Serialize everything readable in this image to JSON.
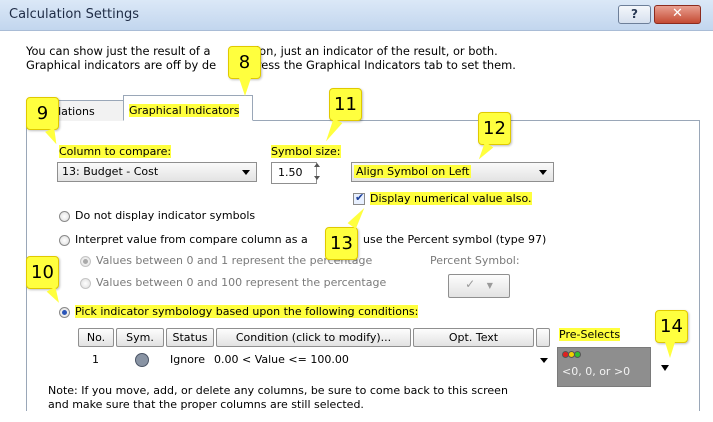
{
  "window": {
    "title": "Calculation Settings",
    "help_glyph": "?",
    "close_glyph": "✕"
  },
  "intro": {
    "line1_a": "You can show just the result of a",
    "line1_b": "ation, just an indicator of the result, or both.",
    "line2_a": "Graphical indicators are off by de",
    "line2_b": "Press the Graphical Indicators tab to set them."
  },
  "tabs": {
    "calculations": "lculations",
    "graphical": "Graphical Indicators"
  },
  "compare": {
    "label": "Column to compare:",
    "value": "13: Budget - Cost"
  },
  "symbol_size": {
    "label": "Symbol size:",
    "value": "1.50"
  },
  "align": {
    "value": "Align Symbol on Left"
  },
  "display_numeric": {
    "label": "Display numerical value also.",
    "checked": true
  },
  "options": {
    "none": "Do not display indicator symbols",
    "interpret_a": "Interpret value from compare column as a",
    "interpret_b": "use the Percent symbol (type 97)",
    "range01": "Values between 0 and 1 represent the percentage",
    "range0100": "Values between 0 and 100 represent the percentage",
    "percent_symbol_label": "Percent Symbol:",
    "pick": "Pick indicator symbology based upon the following conditions:"
  },
  "grid": {
    "headers": [
      "No.",
      "Sym.",
      "Status",
      "Condition (click to modify)...",
      "Opt. Text"
    ],
    "row": {
      "no": "1",
      "status": "Ignore",
      "condition": "0.00 < Value <= 100.00"
    }
  },
  "preselects": {
    "label": "Pre-Selects",
    "text": "<0, 0, or >0",
    "dot_colors": [
      "#e02020",
      "#f0d000",
      "#30c030"
    ]
  },
  "note": {
    "line1": "Note: If you move, add, or delete any columns, be sure to come back to this screen",
    "line2": "and make sure that the proper columns are still selected."
  },
  "callouts": [
    "8",
    "9",
    "10",
    "11",
    "12",
    "13",
    "14"
  ],
  "accent_color": "#ffff3e"
}
